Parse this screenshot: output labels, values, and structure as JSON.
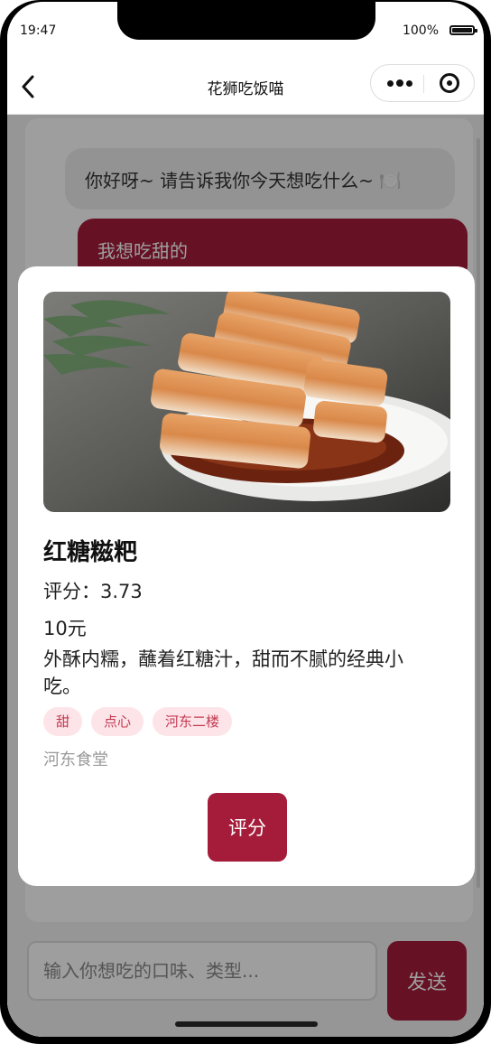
{
  "status_bar": {
    "time": "19:47",
    "battery": "100%"
  },
  "nav": {
    "title": "花狮吃饭喵",
    "back_icon": "chevron-left-icon",
    "more_icon": "more-dots-icon",
    "close_icon": "target-circle-icon"
  },
  "chat": {
    "messages": [
      {
        "role": "bot",
        "text": "你好呀~ 请告诉我你今天想吃什么~ 🍽️"
      },
      {
        "role": "user",
        "text": "我想吃甜的"
      }
    ]
  },
  "input": {
    "placeholder": "输入你想吃的口味、类型..."
  },
  "send_label": "发送",
  "food_card": {
    "name": "红糖糍粑",
    "rating": "评分：3.73",
    "price": "10元",
    "description": "外酥内糯，蘸着红糖汁，甜而不腻的经典小吃。",
    "tags": [
      "甜",
      "点心",
      "河东二楼"
    ],
    "canteen": "河东食堂",
    "rate_label": "评分"
  },
  "colors": {
    "accent": "#a51c3a",
    "tag_bg": "#fde4e8",
    "tag_text": "#c23a52",
    "bot_bubble": "#eeeeee"
  }
}
